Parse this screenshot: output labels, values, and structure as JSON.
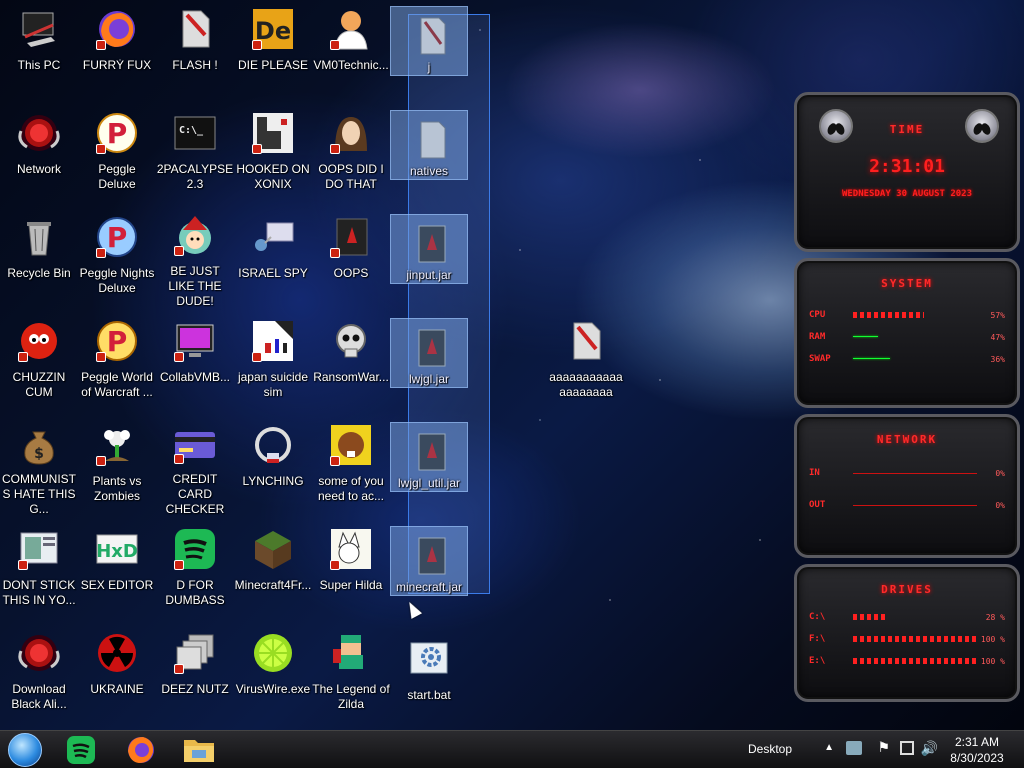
{
  "desktop": {
    "icons": [
      {
        "label": "This PC",
        "icon": "computer-icon"
      },
      {
        "label": "FURRY FUX",
        "icon": "firefox-icon"
      },
      {
        "label": "FLASH !",
        "icon": "file-icon"
      },
      {
        "label": "DIE PLEASE",
        "icon": "die-app-icon"
      },
      {
        "label": "VM0Technic...",
        "icon": "doctor-icon"
      },
      {
        "label": "Network",
        "icon": "alienware-icon"
      },
      {
        "label": "Peggle Deluxe",
        "icon": "peggle-icon"
      },
      {
        "label": "2PACALYPSE 2.3",
        "icon": "terminal-icon"
      },
      {
        "label": "HOOKED ON XONIX",
        "icon": "xonix-icon"
      },
      {
        "label": "OOPS DID I DO THAT",
        "icon": "portrait-icon"
      },
      {
        "label": "Recycle Bin",
        "icon": "recycle-bin-icon"
      },
      {
        "label": "Peggle Nights Deluxe",
        "icon": "peggle-icon"
      },
      {
        "label": "BE JUST LIKE THE DUDE!",
        "icon": "elf-icon"
      },
      {
        "label": "ISRAEL SPY",
        "icon": "network-spy-icon"
      },
      {
        "label": "OOPS",
        "icon": "executable-icon"
      },
      {
        "label": "CHUZZIN CUM",
        "icon": "chuzzle-icon"
      },
      {
        "label": "Peggle World of Warcraft ...",
        "icon": "peggle-icon"
      },
      {
        "label": "CollabVMB...",
        "icon": "monitor-icon"
      },
      {
        "label": "japan suicide sim",
        "icon": "game-icon"
      },
      {
        "label": "RansomWar...",
        "icon": "skull-icon"
      },
      {
        "label": "COMMUNISTS HATE THIS G...",
        "icon": "money-bag-icon"
      },
      {
        "label": "Plants vs Zombies",
        "icon": "flower-icon"
      },
      {
        "label": "CREDIT CARD CHECKER",
        "icon": "credit-card-icon"
      },
      {
        "label": "LYNCHING",
        "icon": "lynching-icon"
      },
      {
        "label": "some of you need to ac...",
        "icon": "beaver-icon"
      },
      {
        "label": "DONT STICK THIS IN YO...",
        "icon": "document-icon"
      },
      {
        "label": "SEX EDITOR",
        "icon": "hex-editor-icon"
      },
      {
        "label": "D FOR DUMBASS",
        "icon": "spotify-icon"
      },
      {
        "label": "Minecraft4Fr...",
        "icon": "minecraft-icon"
      },
      {
        "label": "Super Hilda",
        "icon": "hilda-icon"
      },
      {
        "label": "Download Black Ali...",
        "icon": "alienware-icon"
      },
      {
        "label": "UKRAINE",
        "icon": "radiation-icon"
      },
      {
        "label": "DEEZ NUTZ",
        "icon": "windows-stack-icon"
      },
      {
        "label": "VirusWire.exe",
        "icon": "limewire-icon"
      },
      {
        "label": "The Legend of Zilda",
        "icon": "zelda-icon"
      },
      {
        "label": "aaaaaaaaaaaaaaaaaaa",
        "icon": "file-icon"
      },
      {
        "label": "start.bat",
        "icon": "gear-file-icon"
      }
    ],
    "selected": [
      {
        "label": "j",
        "icon": "folder-icon"
      },
      {
        "label": "natives",
        "icon": "folder-icon"
      },
      {
        "label": "jinput.jar",
        "icon": "jar-icon"
      },
      {
        "label": "lwjgl.jar",
        "icon": "jar-icon"
      },
      {
        "label": "lwjgl_util.jar",
        "icon": "jar-icon"
      },
      {
        "label": "minecraft.jar",
        "icon": "jar-icon"
      }
    ]
  },
  "widget": {
    "time_header": "TIME",
    "time": "2:31:01",
    "date": "WEDNESDAY 30 AUGUST 2023",
    "system_header": "SYSTEM",
    "system": [
      {
        "label": "CPU",
        "value": "57%"
      },
      {
        "label": "RAM",
        "value": "47%"
      },
      {
        "label": "SWAP",
        "value": "36%"
      }
    ],
    "network_header": "NETWORK",
    "network": [
      {
        "label": "IN",
        "value": "0%"
      },
      {
        "label": "OUT",
        "value": "0%"
      }
    ],
    "drives_header": "DRIVES",
    "drives": [
      {
        "label": "C:\\",
        "value": "28 %"
      },
      {
        "label": "F:\\",
        "value": "100 %"
      },
      {
        "label": "E:\\",
        "value": "100 %"
      }
    ]
  },
  "taskbar": {
    "desktop_label": "Desktop",
    "time": "2:31 AM",
    "date": "8/30/2023",
    "pinned": [
      "spotify-icon",
      "firefox-icon",
      "file-explorer-icon"
    ]
  },
  "colors": {
    "accent_red": "#ff2020",
    "selection_blue": "#3b7be8"
  }
}
